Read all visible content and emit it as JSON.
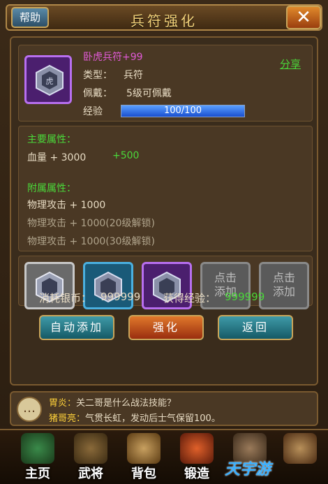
{
  "header": {
    "title": "兵符强化",
    "help_label": "帮助",
    "close_label": "✕"
  },
  "item": {
    "name": "卧虎兵符+99",
    "share_label": "分享",
    "type_label": "类型：",
    "type_value": "兵符",
    "wear_label": "佩戴：",
    "wear_value": "5级可佩戴",
    "exp_label": "经验",
    "exp_value": "100/100",
    "exp_progress": 1.0
  },
  "main_attrs": {
    "heading": "主要属性：",
    "hp_text": "血量 + 3000",
    "hp_bonus": "+500"
  },
  "sub_attrs": {
    "heading": "附属属性：",
    "lines": [
      "物理攻击 + 1000",
      "物理攻击 + 1000(20级解锁)",
      "物理攻击 + 1000(30级解锁)"
    ]
  },
  "slots": [
    {
      "kind": "silver",
      "text": ""
    },
    {
      "kind": "blue",
      "text": ""
    },
    {
      "kind": "purple",
      "text": ""
    },
    {
      "kind": "empty",
      "text": "点击\n添加"
    },
    {
      "kind": "empty",
      "text": "点击\n添加"
    }
  ],
  "empty_slot_line1": "点击",
  "empty_slot_line2": "添加",
  "cost": {
    "label": "消耗银币：",
    "value": "999999",
    "gain_label": "获得经验：",
    "gain_value": "999999"
  },
  "actions": {
    "auto_add": "自动添加",
    "strengthen": "强化",
    "back": "返回"
  },
  "chat": {
    "line1_name": "胃炎：",
    "line1_text": "关二哥是什么战法技能？",
    "line2_name": "猪哥亮：",
    "line2_text": "气贯长虹，发动后士气保留100。"
  },
  "nav": [
    {
      "label": "主页",
      "icon": "pagoda-icon"
    },
    {
      "label": "武将",
      "icon": "general-icon"
    },
    {
      "label": "背包",
      "icon": "bag-icon"
    },
    {
      "label": "锻造",
      "icon": "forge-icon"
    },
    {
      "label": "",
      "icon": "warrior-icon"
    },
    {
      "label": "",
      "icon": "scroll-icon"
    }
  ],
  "watermark": "天宇游",
  "colors": {
    "item_name": "#e05ad6",
    "green": "#4ad83a",
    "gold": "#f3d27a"
  }
}
